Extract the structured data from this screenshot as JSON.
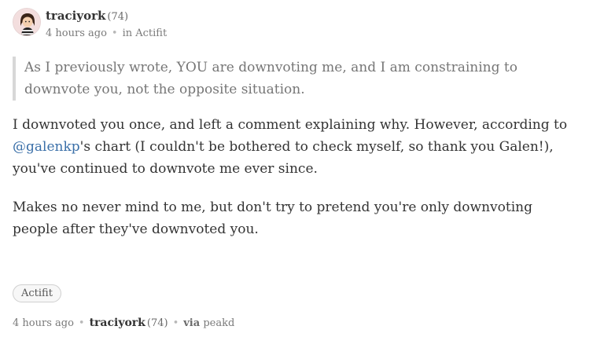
{
  "post": {
    "author": "traciyork",
    "reputation": "(74)",
    "time_ago": "4 hours ago",
    "community_prefix": "in",
    "community": "Actifit",
    "quote": "As I previously wrote, YOU are downvoting me, and I am constraining to downvote you, not the opposite situation.",
    "para1_before": "I downvoted you once, and left a comment explaining why. However, according to ",
    "mention": "@galenkp",
    "para1_after": "'s chart (I couldn't be bothered to check myself, so thank you Galen!), you've continued to downvote me ever since.",
    "para2": "Makes no never mind to me, but don't try to pretend you're only downvoting people after they've downvoted you.",
    "tag": "Actifit"
  },
  "footer": {
    "time_ago": "4 hours ago",
    "author": "traciyork",
    "reputation": "(74)",
    "via_label": "via",
    "app": "peakd"
  },
  "colors": {
    "mention": "#3a6fa8",
    "quote_border": "#d7d7d7",
    "avatar_bg": "#f6e6e6"
  },
  "icons": {
    "avatar": "user-avatar"
  }
}
